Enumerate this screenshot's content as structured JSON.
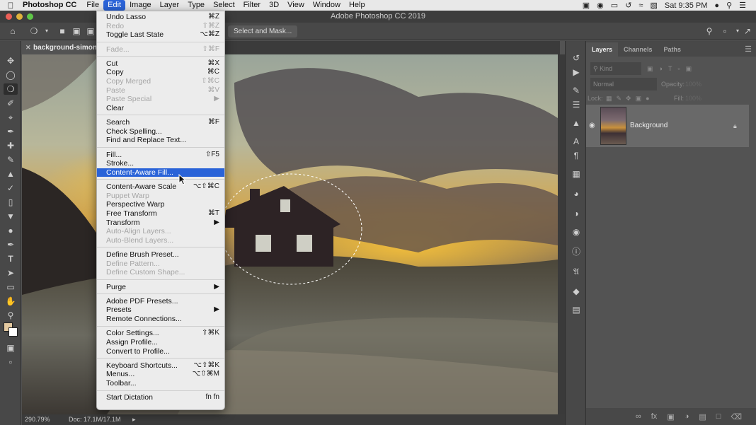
{
  "menubar": {
    "app_name": "Photoshop CC",
    "items": [
      "File",
      "Edit",
      "Image",
      "Layer",
      "Type",
      "Select",
      "Filter",
      "3D",
      "View",
      "Window",
      "Help"
    ],
    "active_item": "Edit",
    "clock": "Sat 9:35 PM"
  },
  "window": {
    "title": "Adobe Photoshop CC 2019"
  },
  "options_bar": {
    "select_mask_label": "Select and Mask..."
  },
  "document_tab": {
    "label": "background-simon-g"
  },
  "status_bar": {
    "zoom": "290.79%",
    "doc_info": "Doc: 17.1M/17.1M"
  },
  "edit_menu": {
    "items": [
      {
        "label": "Undo Lasso",
        "shortcut": "⌘Z",
        "enabled": true
      },
      {
        "label": "Redo",
        "shortcut": "⇧⌘Z",
        "enabled": false
      },
      {
        "label": "Toggle Last State",
        "shortcut": "⌥⌘Z",
        "enabled": true
      },
      {
        "sep": true
      },
      {
        "label": "Fade...",
        "shortcut": "⇧⌘F",
        "enabled": false
      },
      {
        "sep": true
      },
      {
        "label": "Cut",
        "shortcut": "⌘X",
        "enabled": true
      },
      {
        "label": "Copy",
        "shortcut": "⌘C",
        "enabled": true
      },
      {
        "label": "Copy Merged",
        "shortcut": "⇧⌘C",
        "enabled": false
      },
      {
        "label": "Paste",
        "shortcut": "⌘V",
        "enabled": false
      },
      {
        "label": "Paste Special",
        "shortcut": "▶",
        "enabled": false
      },
      {
        "label": "Clear",
        "shortcut": "",
        "enabled": true
      },
      {
        "sep": true
      },
      {
        "label": "Search",
        "shortcut": "⌘F",
        "enabled": true
      },
      {
        "label": "Check Spelling...",
        "shortcut": "",
        "enabled": true
      },
      {
        "label": "Find and Replace Text...",
        "shortcut": "",
        "enabled": true
      },
      {
        "sep": true
      },
      {
        "label": "Fill...",
        "shortcut": "⇧F5",
        "enabled": true
      },
      {
        "label": "Stroke...",
        "shortcut": "",
        "enabled": true
      },
      {
        "label": "Content-Aware Fill...",
        "shortcut": "",
        "enabled": true,
        "highlighted": true
      },
      {
        "sep": true
      },
      {
        "label": "Content-Aware Scale",
        "shortcut": "⌥⇧⌘C",
        "enabled": true
      },
      {
        "label": "Puppet Warp",
        "shortcut": "",
        "enabled": false
      },
      {
        "label": "Perspective Warp",
        "shortcut": "",
        "enabled": true
      },
      {
        "label": "Free Transform",
        "shortcut": "⌘T",
        "enabled": true
      },
      {
        "label": "Transform",
        "shortcut": "▶",
        "enabled": true
      },
      {
        "label": "Auto-Align Layers...",
        "shortcut": "",
        "enabled": false
      },
      {
        "label": "Auto-Blend Layers...",
        "shortcut": "",
        "enabled": false
      },
      {
        "sep": true
      },
      {
        "label": "Define Brush Preset...",
        "shortcut": "",
        "enabled": true
      },
      {
        "label": "Define Pattern...",
        "shortcut": "",
        "enabled": false
      },
      {
        "label": "Define Custom Shape...",
        "shortcut": "",
        "enabled": false
      },
      {
        "sep": true
      },
      {
        "label": "Purge",
        "shortcut": "▶",
        "enabled": true
      },
      {
        "sep": true
      },
      {
        "label": "Adobe PDF Presets...",
        "shortcut": "",
        "enabled": true
      },
      {
        "label": "Presets",
        "shortcut": "▶",
        "enabled": true
      },
      {
        "label": "Remote Connections...",
        "shortcut": "",
        "enabled": true
      },
      {
        "sep": true
      },
      {
        "label": "Color Settings...",
        "shortcut": "⇧⌘K",
        "enabled": true
      },
      {
        "label": "Assign Profile...",
        "shortcut": "",
        "enabled": true
      },
      {
        "label": "Convert to Profile...",
        "shortcut": "",
        "enabled": true
      },
      {
        "sep": true
      },
      {
        "label": "Keyboard Shortcuts...",
        "shortcut": "⌥⇧⌘K",
        "enabled": true
      },
      {
        "label": "Menus...",
        "shortcut": "⌥⇧⌘M",
        "enabled": true
      },
      {
        "label": "Toolbar...",
        "shortcut": "",
        "enabled": true
      },
      {
        "sep": true
      },
      {
        "label": "Start Dictation",
        "shortcut": "fn fn",
        "enabled": true
      }
    ]
  },
  "layers_panel": {
    "tabs": [
      "Layers",
      "Channels",
      "Paths"
    ],
    "active_tab": "Layers",
    "filter_kind": "Kind",
    "blend_mode": "Normal",
    "opacity_label": "Opacity:",
    "opacity_value": "100%",
    "lock_label": "Lock:",
    "fill_label": "Fill:",
    "fill_value": "100%",
    "layers": [
      {
        "name": "Background",
        "visible": true,
        "locked": true
      }
    ]
  },
  "colors": {
    "accent": "#2a63d8",
    "menu_bg": "#ececec",
    "panel_bg": "#535353"
  }
}
